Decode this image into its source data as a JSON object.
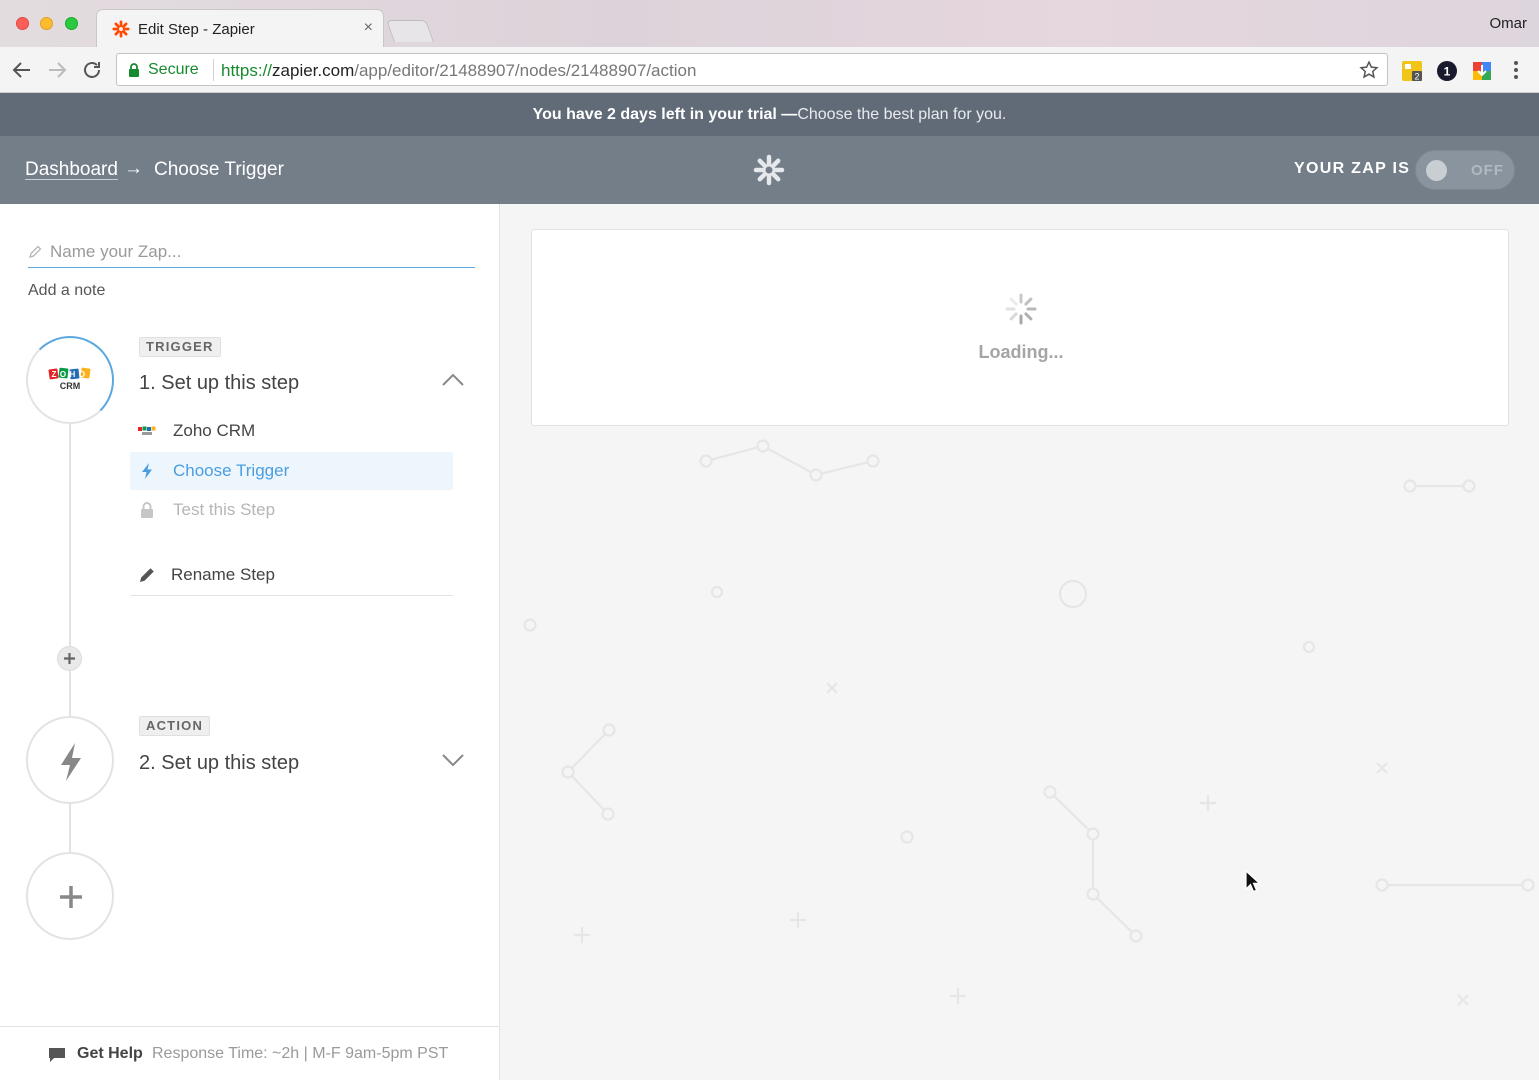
{
  "browser": {
    "tab_title": "Edit Step - Zapier",
    "tab_close": "×",
    "profile_name": "Omar",
    "secure_label": "Secure",
    "url_scheme": "https://",
    "url_host": "zapier.com",
    "url_path": "/app/editor/21488907/nodes/21488907/action",
    "extension_badges": [
      "2",
      "1"
    ]
  },
  "trial_banner": {
    "emphasis": "You have 2 days left in your trial —",
    "link": "Choose the best plan for you."
  },
  "header": {
    "breadcrumb_dashboard": "Dashboard",
    "breadcrumb_arrow": "→",
    "breadcrumb_current": "Choose Trigger",
    "zap_status_label": "YOUR ZAP IS",
    "toggle_state": "OFF"
  },
  "sidebar": {
    "zap_name_placeholder": "Name your Zap...",
    "add_note": "Add a note",
    "trigger": {
      "tag": "TRIGGER",
      "title": "1. Set up this step",
      "logo_top": "ZOHO",
      "logo_bottom": "CRM",
      "items": [
        {
          "label": "Zoho CRM",
          "icon": "zoho-icon"
        },
        {
          "label": "Choose Trigger",
          "icon": "bolt-icon",
          "active": true
        },
        {
          "label": "Test this Step",
          "icon": "lock-icon",
          "disabled": true
        },
        {
          "label": "Rename Step",
          "icon": "pencil-icon"
        }
      ]
    },
    "action": {
      "tag": "ACTION",
      "title": "2. Set up this step"
    },
    "help": {
      "label": "Get Help",
      "response": "Response Time: ~2h  |  M-F 9am-5pm PST"
    }
  },
  "main": {
    "loading_text": "Loading..."
  },
  "colors": {
    "accent_blue": "#4a9ee0",
    "header_bg": "#737e89",
    "banner_bg": "#616b77",
    "zapier_orange": "#ff4a00"
  }
}
